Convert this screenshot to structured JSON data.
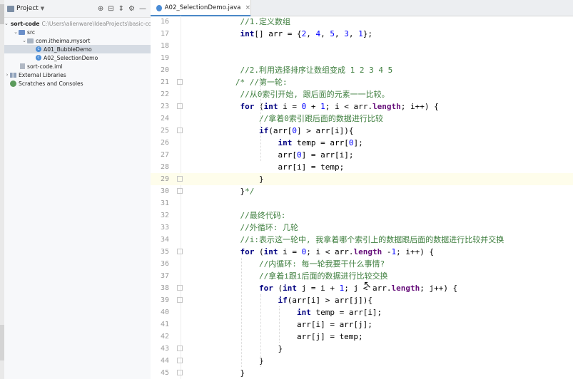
{
  "project_panel": {
    "title": "Project",
    "tree": [
      {
        "label": "sort-code",
        "path": "C:\\Users\\alienware\\IdeaProjects\\basic-code"
      },
      {
        "label": "src"
      },
      {
        "label": "com.itheima.mysort"
      },
      {
        "label": "A01_BubbleDemo"
      },
      {
        "label": "A02_SelectionDemo"
      },
      {
        "label": "sort-code.iml"
      },
      {
        "label": "External Libraries"
      },
      {
        "label": "Scratches and Consoles"
      }
    ]
  },
  "editor": {
    "tab_label": "A02_SelectionDemo.java",
    "current_line": "29",
    "lines": [
      {
        "n": "16",
        "t": "    //1.定义数组"
      },
      {
        "n": "17",
        "t": "    int[] arr = {2, 4, 5, 3, 1};"
      },
      {
        "n": "18",
        "t": ""
      },
      {
        "n": "19",
        "t": ""
      },
      {
        "n": "20",
        "t": "    //2.利用选择排序让数组变成 1 2 3 4 5"
      },
      {
        "n": "21",
        "t": "   /* //第一轮:"
      },
      {
        "n": "22",
        "t": "    //从0索引开始, 跟后面的元素一一比较。"
      },
      {
        "n": "23",
        "t": "    for (int i = 0 + 1; i < arr.length; i++) {"
      },
      {
        "n": "24",
        "t": "        //拿着0索引跟后面的数据进行比较"
      },
      {
        "n": "25",
        "t": "        if(arr[0] > arr[i]){"
      },
      {
        "n": "26",
        "t": "            int temp = arr[0];"
      },
      {
        "n": "27",
        "t": "            arr[0] = arr[i];"
      },
      {
        "n": "28",
        "t": "            arr[i] = temp;"
      },
      {
        "n": "29",
        "t": "        }"
      },
      {
        "n": "30",
        "t": "    }*/"
      },
      {
        "n": "31",
        "t": ""
      },
      {
        "n": "32",
        "t": "    //最终代码:"
      },
      {
        "n": "33",
        "t": "    //外循环: 几轮"
      },
      {
        "n": "34",
        "t": "    //i:表示这一轮中, 我拿着哪个索引上的数据跟后面的数据进行比较并交换"
      },
      {
        "n": "35",
        "t": "    for (int i = 0; i < arr.length -1; i++) {"
      },
      {
        "n": "36",
        "t": "        //内循环: 每一轮我要干什么事情?"
      },
      {
        "n": "37",
        "t": "        //拿着i跟i后面的数据进行比较交换"
      },
      {
        "n": "38",
        "t": "        for (int j = i + 1; j < arr.length; j++) {"
      },
      {
        "n": "39",
        "t": "            if(arr[i] > arr[j]){"
      },
      {
        "n": "40",
        "t": "                int temp = arr[i];"
      },
      {
        "n": "41",
        "t": "                arr[i] = arr[j];"
      },
      {
        "n": "42",
        "t": "                arr[j] = temp;"
      },
      {
        "n": "43",
        "t": "            }"
      },
      {
        "n": "44",
        "t": "        }"
      },
      {
        "n": "45",
        "t": "    }"
      }
    ]
  }
}
